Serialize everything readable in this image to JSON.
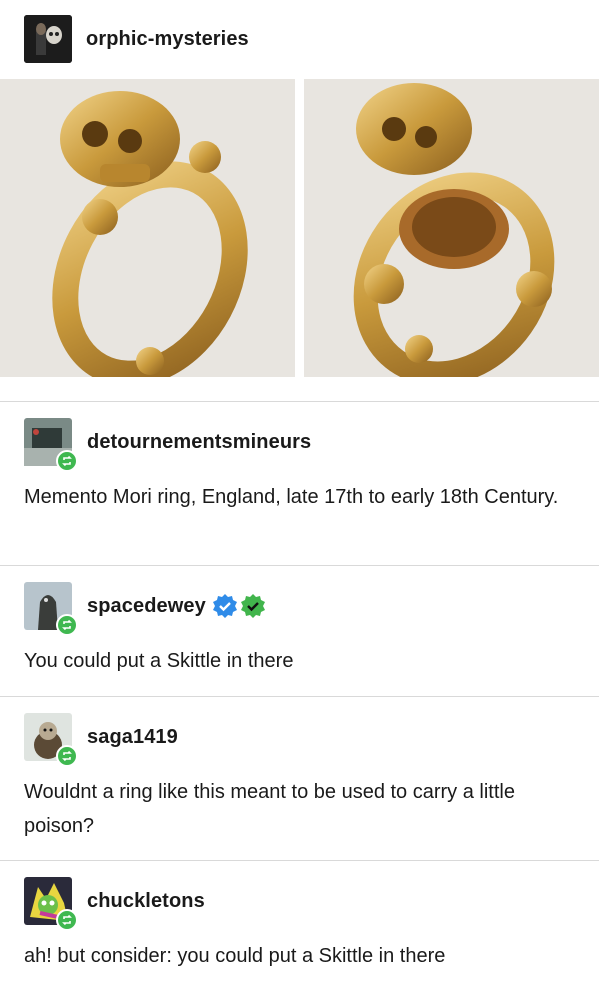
{
  "post": {
    "author": "orphic-mysteries",
    "images": [
      {
        "alt": "memento-mori-ring-closed"
      },
      {
        "alt": "memento-mori-ring-open"
      }
    ]
  },
  "reblogs": [
    {
      "username": "detournementsmineurs",
      "text": "Memento Mori ring, England, late 17th to early 18th Century.",
      "verified_badges": []
    },
    {
      "username": "spacedewey",
      "text": "You could put a Skittle in there",
      "verified_badges": [
        "blue-check-badge",
        "green-check-badge"
      ]
    },
    {
      "username": "saga1419",
      "text": "Wouldnt a ring like this meant to be used to carry a little poison?",
      "verified_badges": []
    },
    {
      "username": "chuckletons",
      "text": "ah! but consider: you could put a Skittle in there",
      "verified_badges": []
    }
  ],
  "colors": {
    "reblog_badge": "#3fb850",
    "blue_badge": "#2f8be8",
    "green_badge": "#41b54c",
    "divider": "#d9d9d9"
  }
}
